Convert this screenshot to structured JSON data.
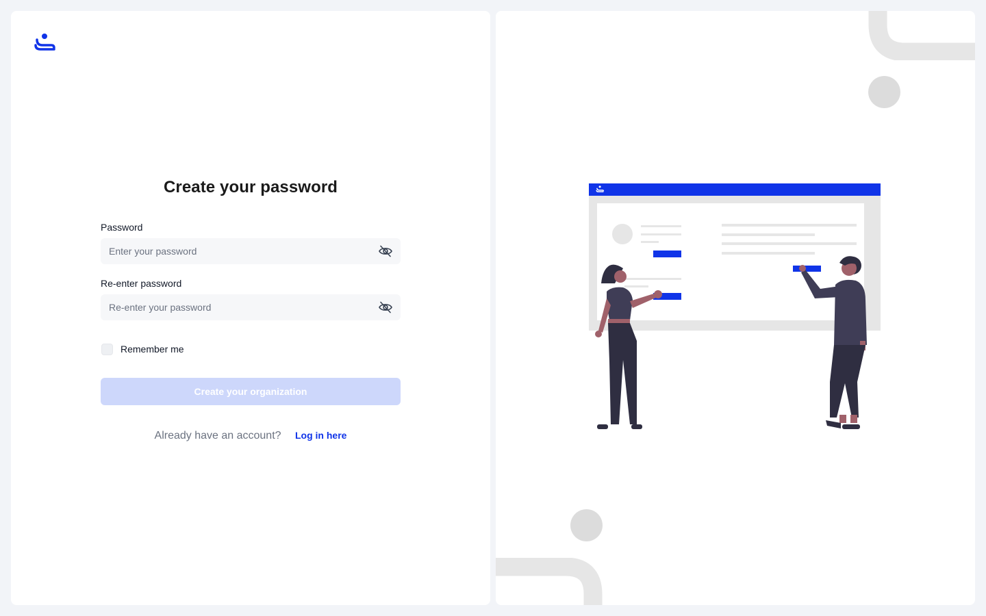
{
  "brand": {
    "logo_icon": "brand-logo-icon",
    "accent": "#1034e8"
  },
  "form": {
    "title": "Create your password",
    "password": {
      "label": "Password",
      "placeholder": "Enter your password",
      "value": ""
    },
    "confirm": {
      "label": "Re-enter password",
      "placeholder": "Re-enter your password",
      "value": ""
    },
    "remember": {
      "label": "Remember me",
      "checked": false
    },
    "submit_label": "Create your organization",
    "submit_color": "#cdd7fb",
    "alt_text": "Already have an account?",
    "alt_link": "Log in here"
  },
  "icons": {
    "toggle_visibility": "eye-off-icon"
  },
  "illustration": {
    "description_icon": "onboarding-illustration",
    "colors": {
      "bar": "#1034e8",
      "frame": "#e6e6e6",
      "figure": "#3f3d56",
      "skin": "#a0616a"
    }
  }
}
